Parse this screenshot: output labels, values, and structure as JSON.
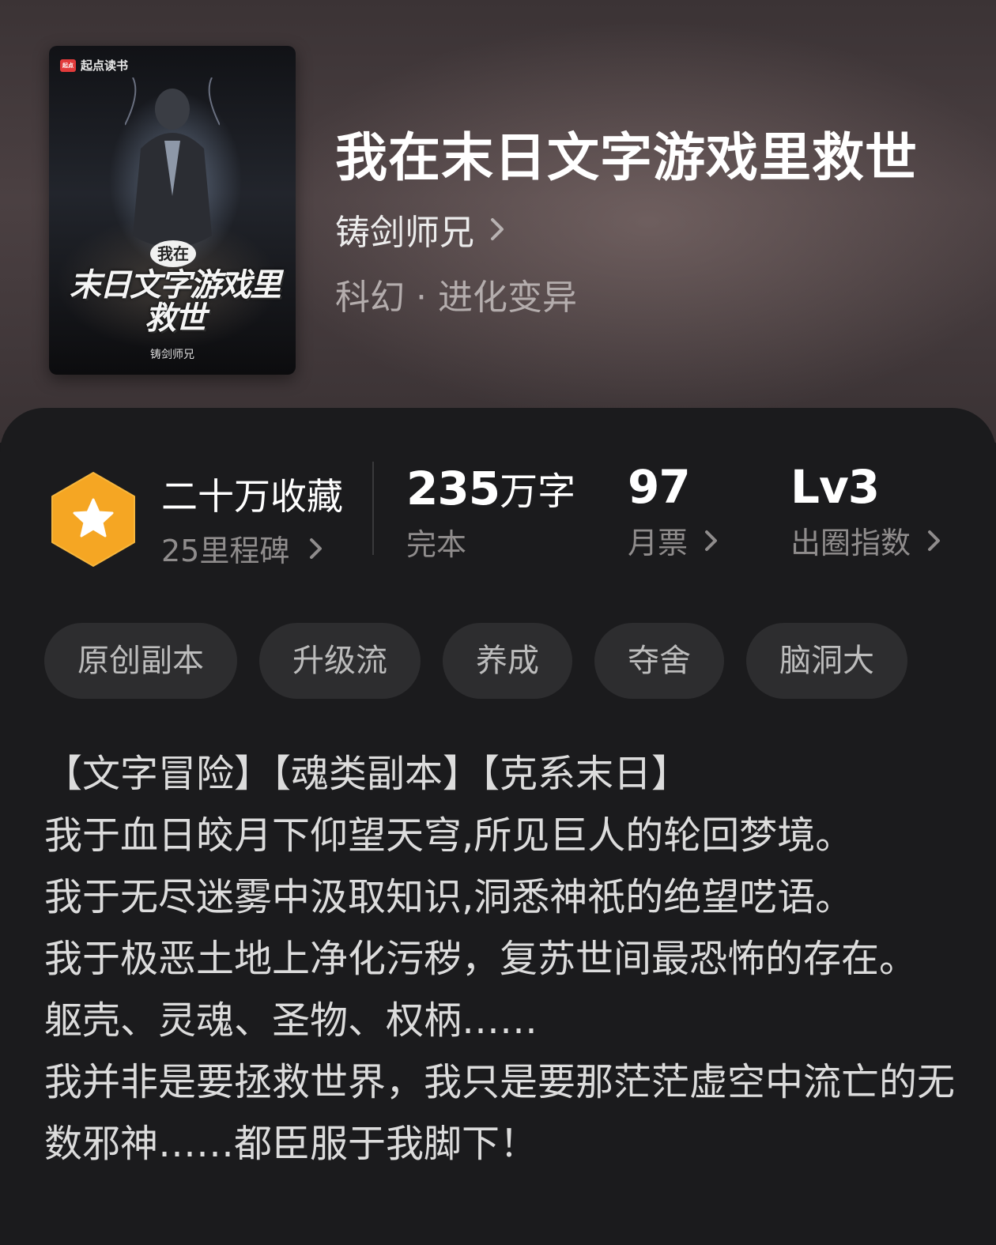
{
  "book": {
    "title": "我在末日文字游戏里救世",
    "author": "铸剑师兄",
    "category": "科幻 · 进化变异"
  },
  "cover": {
    "publisher": "起点读书",
    "publisher_mark": "起点",
    "title_small": "我在",
    "title_big": "末日文字游戏里救世",
    "author": "铸剑师兄"
  },
  "stats": {
    "favorites": {
      "value": "二十万收藏",
      "sub": "25里程碑"
    },
    "words": {
      "number": "235",
      "unit": "万字",
      "label": "完本"
    },
    "monthly_votes": {
      "value": "97",
      "label": "月票"
    },
    "popularity": {
      "value": "Lv3",
      "label": "出圈指数"
    }
  },
  "tags": [
    "原创副本",
    "升级流",
    "养成",
    "夺舍",
    "脑洞大"
  ],
  "description": "【文字冒险】【魂类副本】【克系末日】\n我于血日皎月下仰望天穹,所见巨人的轮回梦境。\n我于无尽迷雾中汲取知识,洞悉神祇的绝望呓语。\n我于极恶土地上净化污秽，复苏世间最恐怖的存在。\n躯壳、灵魂、圣物、权柄……\n我并非是要拯救世界，我只是要那茫茫虚空中流亡的无数邪神……都臣服于我脚下！",
  "colors": {
    "badge_orange": "#f5a623",
    "panel_bg": "#1b1b1d",
    "tag_bg": "#2d2d2f"
  }
}
